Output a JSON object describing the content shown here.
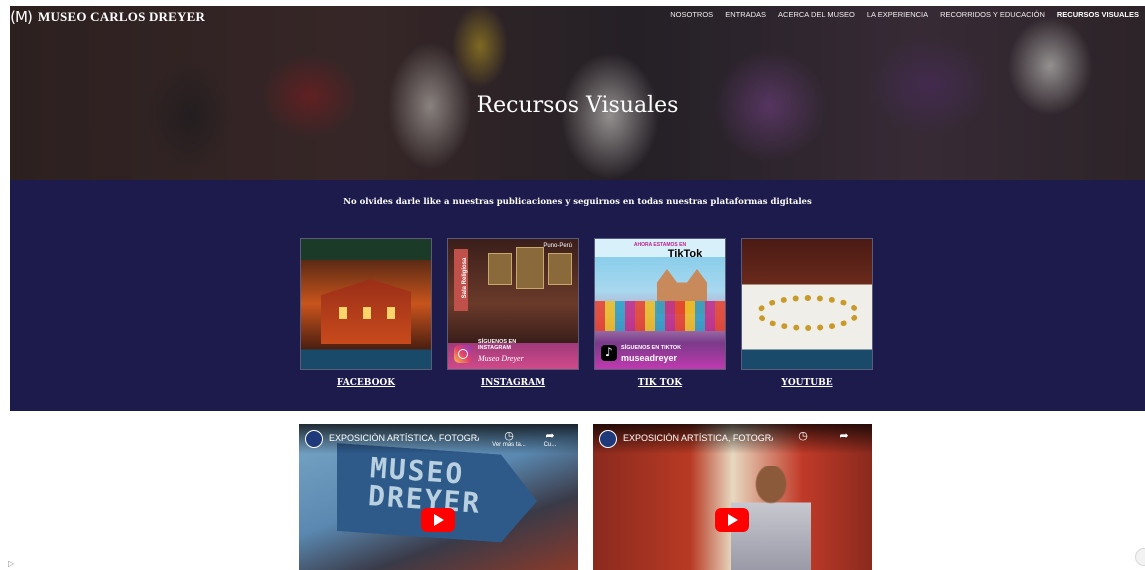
{
  "header": {
    "logo_mark": "(M)",
    "brand": "MUSEO CARLOS DREYER",
    "nav": [
      {
        "label": "NOSOTROS"
      },
      {
        "label": "ENTRADAS"
      },
      {
        "label": "ACERCA DEL MUSEO"
      },
      {
        "label": "LA EXPERIENCIA"
      },
      {
        "label": "RECORRIDOS Y EDUCACIÓN"
      },
      {
        "label": "RECURSOS VISUALES",
        "active": true
      }
    ]
  },
  "hero": {
    "title": "Recursos Visuales"
  },
  "social": {
    "intro": "No olvides darle like a nuestras publicaciones y seguirnos en todas nuestras plataformas digitales",
    "cards": [
      {
        "label": "FACEBOOK"
      },
      {
        "label": "INSTAGRAM",
        "badge": "Puno-Perú",
        "side": "Sala Religiosa",
        "follow": "SÍGUENOS EN INSTAGRAM",
        "handle": "Museo Dreyer"
      },
      {
        "label": "TIK TOK",
        "top": "AHORA ESTAMOS EN",
        "brand": "TikTok",
        "follow": "SÍGUENOS EN TIKTOK",
        "handle": "museadreyer"
      },
      {
        "label": "YOUTUBE"
      }
    ]
  },
  "videos": [
    {
      "title": "EXPOSICIÓN ARTÍSTICA, FOTOGRÁF...",
      "watch_later": "Ver más ta...",
      "share": "Cu...",
      "sign_text": "MUSEO\nDREYER"
    },
    {
      "title": "EXPOSICIÓN ARTÍSTICA, FOTOGRÁ..."
    }
  ],
  "icons": {
    "play": "youtube-play-icon",
    "clock": "watch-later-icon",
    "share": "share-icon"
  },
  "colors": {
    "band": "#1d1b4c",
    "play": "#ff0000"
  }
}
